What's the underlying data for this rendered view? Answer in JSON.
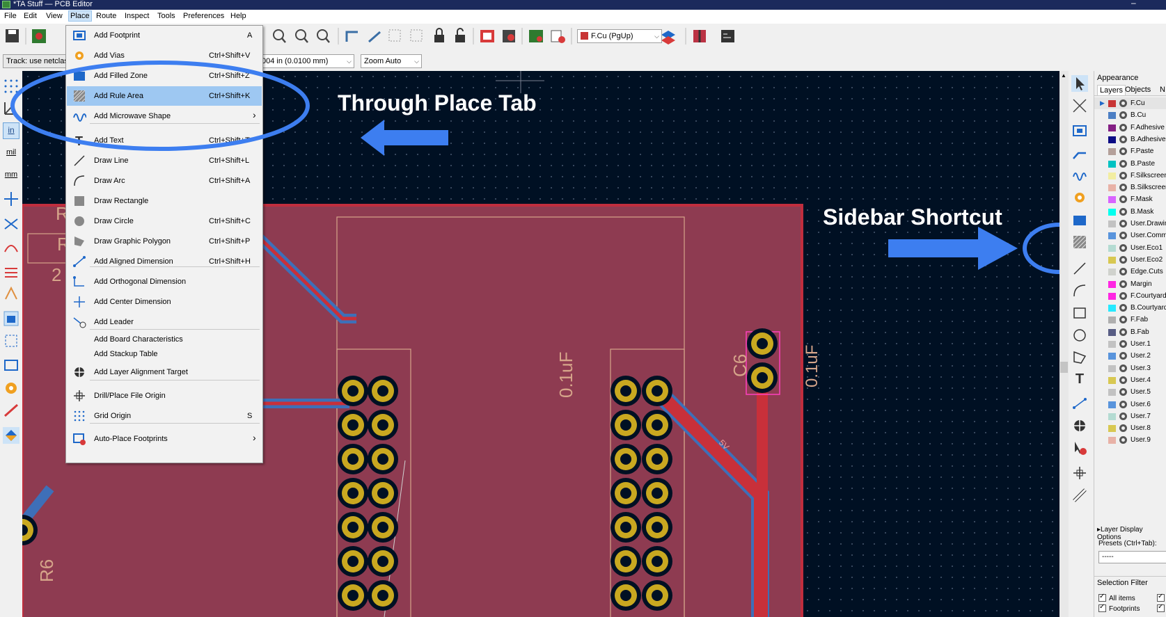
{
  "window": {
    "title": "*TA Stuff — PCB Editor",
    "minimize": "–"
  },
  "menubar": [
    "File",
    "Edit",
    "View",
    "Place",
    "Route",
    "Inspect",
    "Tools",
    "Preferences",
    "Help"
  ],
  "toolbar2": {
    "track_label": "Track: use netclass",
    "grid_value": "004 in (0.0100 mm)",
    "zoom_value": "Zoom Auto"
  },
  "layer_combo": "F.Cu (PgUp)",
  "left_toolbar": {
    "in_label": "in",
    "mil_label": "mil",
    "mm_label": "mm"
  },
  "place_menu": [
    {
      "label": "Add Footprint",
      "shortcut": "A",
      "icon": "footprint-icon"
    },
    {
      "label": "Add Vias",
      "shortcut": "Ctrl+Shift+V",
      "icon": "via-icon"
    },
    {
      "label": "Add Filled Zone",
      "shortcut": "Ctrl+Shift+Z",
      "icon": "zone-icon"
    },
    {
      "label": "Add Rule Area",
      "shortcut": "Ctrl+Shift+K",
      "icon": "rule-area-icon",
      "highlighted": true
    },
    {
      "label": "Add Microwave Shape",
      "shortcut": "",
      "icon": "microwave-icon",
      "submenu": true
    },
    {
      "label": "Add Text",
      "shortcut": "Ctrl+Shift+T",
      "icon": "text-icon"
    },
    {
      "label": "Draw Line",
      "shortcut": "Ctrl+Shift+L",
      "icon": "line-icon"
    },
    {
      "label": "Draw Arc",
      "shortcut": "Ctrl+Shift+A",
      "icon": "arc-icon"
    },
    {
      "label": "Draw Rectangle",
      "shortcut": "",
      "icon": "rectangle-icon"
    },
    {
      "label": "Draw Circle",
      "shortcut": "Ctrl+Shift+C",
      "icon": "circle-icon"
    },
    {
      "label": "Draw Graphic Polygon",
      "shortcut": "Ctrl+Shift+P",
      "icon": "polygon-icon"
    },
    {
      "label": "Add Aligned Dimension",
      "shortcut": "Ctrl+Shift+H",
      "icon": "aligned-dimension-icon"
    },
    {
      "label": "Add Orthogonal Dimension",
      "shortcut": "",
      "icon": "orthogonal-dimension-icon"
    },
    {
      "label": "Add Center Dimension",
      "shortcut": "",
      "icon": "center-dimension-icon"
    },
    {
      "label": "Add Leader",
      "shortcut": "",
      "icon": "leader-icon"
    },
    {
      "label": "Add Board Characteristics",
      "shortcut": "",
      "icon": ""
    },
    {
      "label": "Add Stackup Table",
      "shortcut": "",
      "icon": ""
    },
    {
      "label": "Add Layer Alignment Target",
      "shortcut": "",
      "icon": "alignment-target-icon"
    },
    {
      "label": "Drill/Place File Origin",
      "shortcut": "",
      "icon": "drill-origin-icon"
    },
    {
      "label": "Grid Origin",
      "shortcut": "S",
      "icon": "grid-origin-icon"
    },
    {
      "label": "Auto-Place Footprints",
      "shortcut": "",
      "icon": "autoplace-icon",
      "submenu": true
    }
  ],
  "annotations": {
    "place_tab": "Through Place Tab",
    "sidebar": "Sidebar Shortcut"
  },
  "board_labels": {
    "cap1_value": "0.1uF",
    "cap2_ref": "C6",
    "cap2_value": "0.1uF",
    "trace_5v": "5V",
    "r_ref_partial": "R",
    "r6": "R6",
    "num_partial": "2"
  },
  "appearance": {
    "title": "Appearance",
    "tabs": [
      "Layers",
      "Objects",
      "N"
    ],
    "layers": [
      {
        "name": "F.Cu",
        "color": "#c83434"
      },
      {
        "name": "B.Cu",
        "color": "#4d7fc4"
      },
      {
        "name": "F.Adhesive",
        "color": "#841f84"
      },
      {
        "name": "B.Adhesive",
        "color": "#0b0b84"
      },
      {
        "name": "F.Paste",
        "color": "#b4a09a"
      },
      {
        "name": "B.Paste",
        "color": "#00c2c2"
      },
      {
        "name": "F.Silkscreen",
        "color": "#f2eda1"
      },
      {
        "name": "B.Silkscreen",
        "color": "#e8b2a7"
      },
      {
        "name": "F.Mask",
        "color": "#d864ff"
      },
      {
        "name": "B.Mask",
        "color": "#02ffee"
      },
      {
        "name": "User.Drawings",
        "color": "#c2c2c2"
      },
      {
        "name": "User.Comments",
        "color": "#5994dc"
      },
      {
        "name": "User.Eco1",
        "color": "#b4dbd2"
      },
      {
        "name": "User.Eco2",
        "color": "#d8c852"
      },
      {
        "name": "Edge.Cuts",
        "color": "#d0d2cd"
      },
      {
        "name": "Margin",
        "color": "#ff26e2"
      },
      {
        "name": "F.Courtyard",
        "color": "#ff26e2"
      },
      {
        "name": "B.Courtyard",
        "color": "#26e9ff"
      },
      {
        "name": "F.Fab",
        "color": "#afafaf"
      },
      {
        "name": "B.Fab",
        "color": "#585d84"
      },
      {
        "name": "User.1",
        "color": "#c2c2c2"
      },
      {
        "name": "User.2",
        "color": "#5994dc"
      },
      {
        "name": "User.3",
        "color": "#c2c2c2"
      },
      {
        "name": "User.4",
        "color": "#d8c852"
      },
      {
        "name": "User.5",
        "color": "#c2c2c2"
      },
      {
        "name": "User.6",
        "color": "#5994dc"
      },
      {
        "name": "User.7",
        "color": "#b4dbd2"
      },
      {
        "name": "User.8",
        "color": "#d8c852"
      },
      {
        "name": "User.9",
        "color": "#e8b2a7"
      }
    ],
    "layer_display_options": "Layer Display Options",
    "presets_label": "Presets (Ctrl+Tab):",
    "presets_value": "-----",
    "selection_filter": "Selection Filter",
    "filters": [
      "All items",
      "Footprints"
    ]
  }
}
